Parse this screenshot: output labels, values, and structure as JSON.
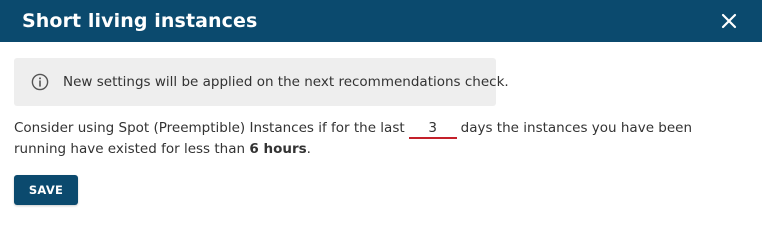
{
  "dialog": {
    "title": "Short living instances",
    "close_icon": "close-icon"
  },
  "info": {
    "icon": "info-circle-icon",
    "text": "New settings will be applied on the next recommendations check."
  },
  "description": {
    "part1": "Consider using Spot (Preemptible) Instances if for the last",
    "days_value": "3",
    "part2": "days the instances you have been running have existed for less than",
    "hours": "6 hours",
    "end": "."
  },
  "actions": {
    "save_label": "SAVE"
  },
  "colors": {
    "header_bg": "#0b4a6e",
    "info_bg": "#eeeeee",
    "input_underline": "#c4202a",
    "button_bg": "#0b4a6e"
  }
}
